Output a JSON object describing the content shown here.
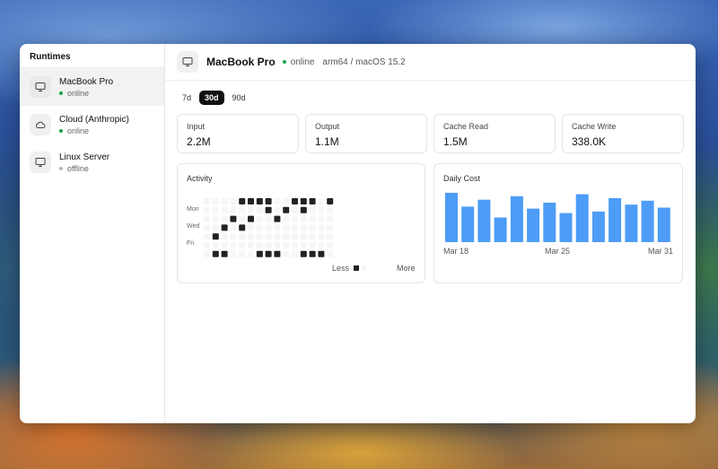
{
  "sidebar": {
    "title": "Runtimes",
    "items": [
      {
        "name": "MacBook Pro",
        "status": "online",
        "icon": "monitor-icon",
        "status_color": "#1aa34a"
      },
      {
        "name": "Cloud (Anthropic)",
        "status": "online",
        "icon": "cloud-icon",
        "status_color": "#1aa34a"
      },
      {
        "name": "Linux Server",
        "status": "offline",
        "icon": "monitor-icon",
        "status_color": "#b5b5b5"
      }
    ]
  },
  "header": {
    "title": "MacBook Pro",
    "status": "online",
    "meta": "arm64 / macOS 15.2"
  },
  "ranges": [
    "7d",
    "30d",
    "90d"
  ],
  "active_range": "30d",
  "stats": [
    {
      "label": "Input",
      "value": "2.2M"
    },
    {
      "label": "Output",
      "value": "1.1M"
    },
    {
      "label": "Cache Read",
      "value": "1.5M"
    },
    {
      "label": "Cache Write",
      "value": "338.0K"
    }
  ],
  "activity": {
    "title": "Activity",
    "day_labels": [
      "Mon",
      "Wed",
      "Fri"
    ],
    "legend_less": "Less",
    "legend_more": "More",
    "colors": [
      "#f6f6f6",
      "#222222"
    ],
    "weeks": [
      [
        0,
        0,
        0,
        0,
        0,
        0,
        0
      ],
      [
        0,
        0,
        0,
        0,
        1,
        0,
        1
      ],
      [
        0,
        0,
        0,
        1,
        0,
        0,
        1
      ],
      [
        0,
        0,
        1,
        0,
        0,
        0,
        0
      ],
      [
        1,
        0,
        0,
        1,
        0,
        0,
        0
      ],
      [
        1,
        0,
        1,
        0,
        0,
        0,
        0
      ],
      [
        1,
        0,
        0,
        0,
        0,
        0,
        1
      ],
      [
        1,
        1,
        0,
        0,
        0,
        0,
        1
      ],
      [
        0,
        0,
        1,
        0,
        0,
        0,
        1
      ],
      [
        0,
        1,
        0,
        0,
        0,
        0,
        0
      ],
      [
        1,
        0,
        0,
        0,
        0,
        0,
        0
      ],
      [
        1,
        1,
        0,
        0,
        0,
        0,
        1
      ],
      [
        1,
        0,
        0,
        0,
        0,
        0,
        1
      ],
      [
        0,
        0,
        0,
        0,
        0,
        0,
        1
      ],
      [
        1,
        0,
        0,
        0,
        0,
        0,
        0
      ]
    ]
  },
  "cost": {
    "title": "Daily Cost",
    "bar_color": "#4d9cf6",
    "x_labels": [
      "Mar 18",
      "Mar 25",
      "Mar 31"
    ]
  },
  "chart_data": {
    "type": "bar",
    "title": "Daily Cost",
    "categories": [
      "Mar 18",
      "Mar 19",
      "Mar 20",
      "Mar 21",
      "Mar 22",
      "Mar 23",
      "Mar 24",
      "Mar 25",
      "Mar 26",
      "Mar 27",
      "Mar 28",
      "Mar 29",
      "Mar 30",
      "Mar 31"
    ],
    "values": [
      1.0,
      0.72,
      0.86,
      0.5,
      0.93,
      0.68,
      0.8,
      0.59,
      0.97,
      0.62,
      0.89,
      0.76,
      0.84,
      0.7
    ],
    "xlabel": "",
    "ylabel": "",
    "ylim": [
      0,
      1
    ],
    "grid": false
  }
}
